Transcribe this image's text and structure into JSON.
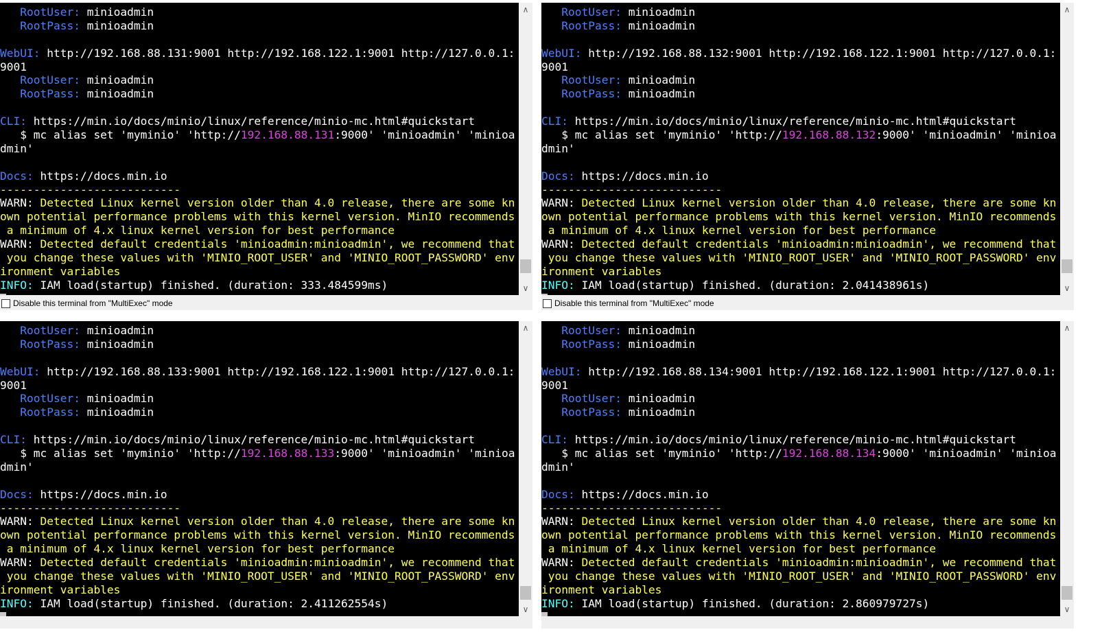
{
  "ui": {
    "disable_label": "Disable this terminal from \"MultiExec\" mode",
    "scroll_up_glyph": "∧",
    "scroll_down_glyph": "∨"
  },
  "terminals": [
    {
      "lines": [
        {
          "k": "cred",
          "label": "   RootUser:",
          "value": " minioadmin"
        },
        {
          "k": "cred",
          "label": "   RootPass:",
          "value": " minioadmin"
        },
        {
          "k": "blank"
        },
        {
          "k": "lbl",
          "label": "WebUI:",
          "value": " http://192.168.88.131:9001 http://192.168.122.1:9001 http://127.0.0.1:"
        },
        {
          "k": "plain",
          "value": "9001"
        },
        {
          "k": "cred",
          "label": "   RootUser:",
          "value": " minioadmin"
        },
        {
          "k": "cred",
          "label": "   RootPass:",
          "value": " minioadmin"
        },
        {
          "k": "blank"
        },
        {
          "k": "lbl",
          "label": "CLI:",
          "value": " https://min.io/docs/minio/linux/reference/minio-mc.html#quickstart"
        },
        {
          "k": "mc",
          "pre": "   $ mc alias set 'myminio' 'http://",
          "ip": "192.168.88.131",
          "post": ":9000' 'minioadmin' 'minioa"
        },
        {
          "k": "plain",
          "value": "dmin'"
        },
        {
          "k": "blank"
        },
        {
          "k": "lbl",
          "label": "Docs:",
          "value": " https://docs.min.io"
        },
        {
          "k": "yel",
          "value": "---------------------------"
        },
        {
          "k": "warn",
          "prefix": "WARN:",
          "value": " Detected Linux kernel version older than 4.0 release, there are some kn"
        },
        {
          "k": "yel",
          "value": "own potential performance problems with this kernel version. MinIO recommends"
        },
        {
          "k": "yel",
          "value": " a minimum of 4.x linux kernel version for best performance"
        },
        {
          "k": "warn",
          "prefix": "WARN:",
          "value": " Detected default credentials 'minioadmin:minioadmin', we recommend that"
        },
        {
          "k": "yel",
          "value": " you change these values with 'MINIO_ROOT_USER' and 'MINIO_ROOT_PASSWORD' env"
        },
        {
          "k": "yel",
          "value": "ironment variables"
        },
        {
          "k": "info",
          "prefix": "INFO:",
          "value": " IAM load(startup) finished. (duration: 333.484599ms)"
        },
        {
          "k": "cursor"
        }
      ]
    },
    {
      "lines": [
        {
          "k": "cred",
          "label": "   RootUser:",
          "value": " minioadmin"
        },
        {
          "k": "cred",
          "label": "   RootPass:",
          "value": " minioadmin"
        },
        {
          "k": "blank"
        },
        {
          "k": "lbl",
          "label": "WebUI:",
          "value": " http://192.168.88.132:9001 http://192.168.122.1:9001 http://127.0.0.1:"
        },
        {
          "k": "plain",
          "value": "9001"
        },
        {
          "k": "cred",
          "label": "   RootUser:",
          "value": " minioadmin"
        },
        {
          "k": "cred",
          "label": "   RootPass:",
          "value": " minioadmin"
        },
        {
          "k": "blank"
        },
        {
          "k": "lbl",
          "label": "CLI:",
          "value": " https://min.io/docs/minio/linux/reference/minio-mc.html#quickstart"
        },
        {
          "k": "mc",
          "pre": "   $ mc alias set 'myminio' 'http://",
          "ip": "192.168.88.132",
          "post": ":9000' 'minioadmin' 'minioa"
        },
        {
          "k": "plain",
          "value": "dmin'"
        },
        {
          "k": "blank"
        },
        {
          "k": "lbl",
          "label": "Docs:",
          "value": " https://docs.min.io"
        },
        {
          "k": "yel",
          "value": "---------------------------"
        },
        {
          "k": "warn",
          "prefix": "WARN:",
          "value": " Detected Linux kernel version older than 4.0 release, there are some kn"
        },
        {
          "k": "yel",
          "value": "own potential performance problems with this kernel version. MinIO recommends"
        },
        {
          "k": "yel",
          "value": " a minimum of 4.x linux kernel version for best performance"
        },
        {
          "k": "warn",
          "prefix": "WARN:",
          "value": " Detected default credentials 'minioadmin:minioadmin', we recommend that"
        },
        {
          "k": "yel",
          "value": " you change these values with 'MINIO_ROOT_USER' and 'MINIO_ROOT_PASSWORD' env"
        },
        {
          "k": "yel",
          "value": "ironment variables"
        },
        {
          "k": "info",
          "prefix": "INFO:",
          "value": " IAM load(startup) finished. (duration: 2.041438961s)"
        },
        {
          "k": "cursor"
        }
      ]
    },
    {
      "lines": [
        {
          "k": "cred",
          "label": "   RootUser:",
          "value": " minioadmin"
        },
        {
          "k": "cred",
          "label": "   RootPass:",
          "value": " minioadmin"
        },
        {
          "k": "blank"
        },
        {
          "k": "lbl",
          "label": "WebUI:",
          "value": " http://192.168.88.133:9001 http://192.168.122.1:9001 http://127.0.0.1:"
        },
        {
          "k": "plain",
          "value": "9001"
        },
        {
          "k": "cred",
          "label": "   RootUser:",
          "value": " minioadmin"
        },
        {
          "k": "cred",
          "label": "   RootPass:",
          "value": " minioadmin"
        },
        {
          "k": "blank"
        },
        {
          "k": "lbl",
          "label": "CLI:",
          "value": " https://min.io/docs/minio/linux/reference/minio-mc.html#quickstart"
        },
        {
          "k": "mc",
          "pre": "   $ mc alias set 'myminio' 'http://",
          "ip": "192.168.88.133",
          "post": ":9000' 'minioadmin' 'minioa"
        },
        {
          "k": "plain",
          "value": "dmin'"
        },
        {
          "k": "blank"
        },
        {
          "k": "lbl",
          "label": "Docs:",
          "value": " https://docs.min.io"
        },
        {
          "k": "yel",
          "value": "---------------------------"
        },
        {
          "k": "warn",
          "prefix": "WARN:",
          "value": " Detected Linux kernel version older than 4.0 release, there are some kn"
        },
        {
          "k": "yel",
          "value": "own potential performance problems with this kernel version. MinIO recommends"
        },
        {
          "k": "yel",
          "value": " a minimum of 4.x linux kernel version for best performance"
        },
        {
          "k": "warn",
          "prefix": "WARN:",
          "value": " Detected default credentials 'minioadmin:minioadmin', we recommend that"
        },
        {
          "k": "yel",
          "value": " you change these values with 'MINIO_ROOT_USER' and 'MINIO_ROOT_PASSWORD' env"
        },
        {
          "k": "yel",
          "value": "ironment variables"
        },
        {
          "k": "info",
          "prefix": "INFO:",
          "value": " IAM load(startup) finished. (duration: 2.411262554s)"
        },
        {
          "k": "cursor"
        }
      ]
    },
    {
      "lines": [
        {
          "k": "cred",
          "label": "   RootUser:",
          "value": " minioadmin"
        },
        {
          "k": "cred",
          "label": "   RootPass:",
          "value": " minioadmin"
        },
        {
          "k": "blank"
        },
        {
          "k": "lbl",
          "label": "WebUI:",
          "value": " http://192.168.88.134:9001 http://192.168.122.1:9001 http://127.0.0.1:"
        },
        {
          "k": "plain",
          "value": "9001"
        },
        {
          "k": "cred",
          "label": "   RootUser:",
          "value": " minioadmin"
        },
        {
          "k": "cred",
          "label": "   RootPass:",
          "value": " minioadmin"
        },
        {
          "k": "blank"
        },
        {
          "k": "lbl",
          "label": "CLI:",
          "value": " https://min.io/docs/minio/linux/reference/minio-mc.html#quickstart"
        },
        {
          "k": "mc",
          "pre": "   $ mc alias set 'myminio' 'http://",
          "ip": "192.168.88.134",
          "post": ":9000' 'minioadmin' 'minioa"
        },
        {
          "k": "plain",
          "value": "dmin'"
        },
        {
          "k": "blank"
        },
        {
          "k": "lbl",
          "label": "Docs:",
          "value": " https://docs.min.io"
        },
        {
          "k": "yel",
          "value": "---------------------------"
        },
        {
          "k": "warn",
          "prefix": "WARN:",
          "value": " Detected Linux kernel version older than 4.0 release, there are some kn"
        },
        {
          "k": "yel",
          "value": "own potential performance problems with this kernel version. MinIO recommends"
        },
        {
          "k": "yel",
          "value": " a minimum of 4.x linux kernel version for best performance"
        },
        {
          "k": "warn",
          "prefix": "WARN:",
          "value": " Detected default credentials 'minioadmin:minioadmin', we recommend that"
        },
        {
          "k": "yel",
          "value": " you change these values with 'MINIO_ROOT_USER' and 'MINIO_ROOT_PASSWORD' env"
        },
        {
          "k": "yel",
          "value": "ironment variables"
        },
        {
          "k": "info",
          "prefix": "INFO:",
          "value": " IAM load(startup) finished. (duration: 2.860979727s)"
        },
        {
          "k": "cursor"
        }
      ]
    }
  ]
}
